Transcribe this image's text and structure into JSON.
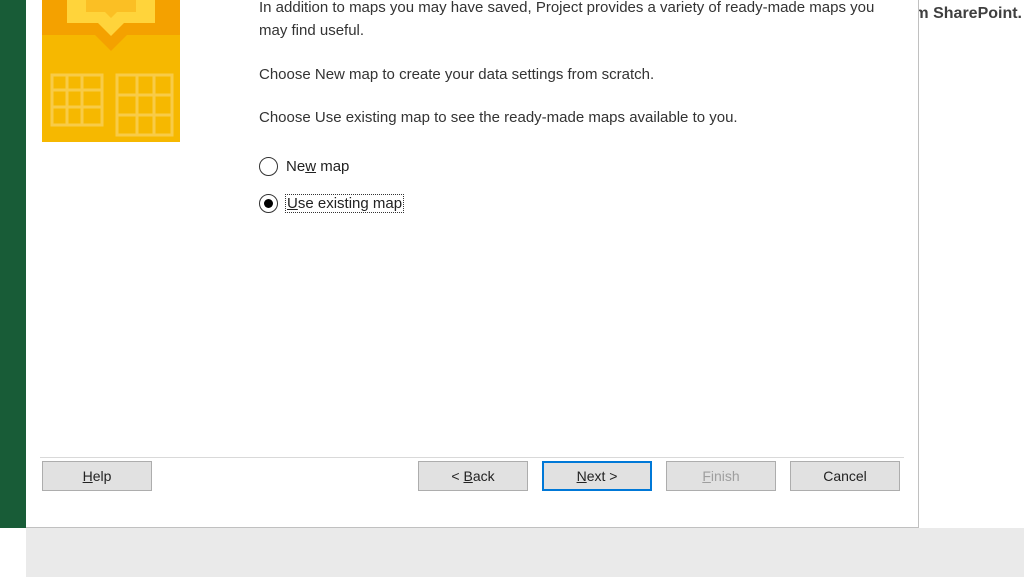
{
  "background": {
    "sharepoint_fragment": "m SharePoint."
  },
  "wizard": {
    "intro_text": "In addition to maps you may have saved, Project provides a variety of ready-made maps you may find useful.",
    "choose_new_text": "Choose New map to create your data settings from scratch.",
    "choose_existing_text": "Choose Use existing map to see the ready-made maps available to you.",
    "options": {
      "new_map": {
        "prefix": "Ne",
        "mnemonic": "w",
        "suffix": " map",
        "selected": false
      },
      "use_existing": {
        "mnemonic": "U",
        "suffix": "se existing map",
        "selected": true
      }
    },
    "buttons": {
      "help_mnemonic": "H",
      "help_suffix": "elp",
      "back_prefix": "< ",
      "back_mnemonic": "B",
      "back_suffix": "ack",
      "next_mnemonic": "N",
      "next_suffix": "ext >",
      "finish_mnemonic": "F",
      "finish_suffix": "inish",
      "cancel": "Cancel"
    }
  }
}
